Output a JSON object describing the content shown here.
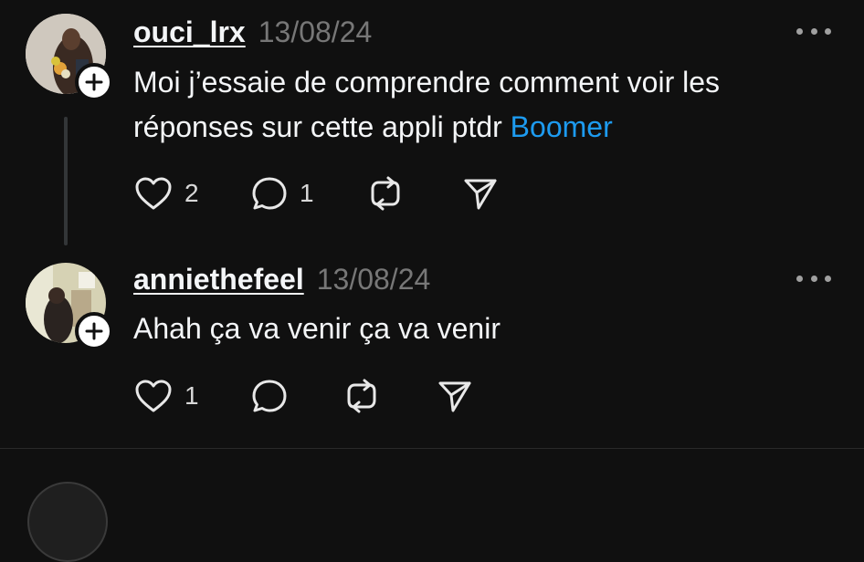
{
  "colors": {
    "background": "#101010",
    "text": "#f3f5f7",
    "muted": "#777777",
    "mention": "#1d9bf0"
  },
  "posts": [
    {
      "username": "ouci_lrx",
      "timestamp": "13/08/24",
      "text": "Moi j’essaie de comprendre comment voir les réponses sur cette appli ptdr ",
      "mention": "Boomer",
      "likes": "2",
      "replies": "1"
    },
    {
      "username": "anniethefeel",
      "timestamp": "13/08/24",
      "text": "Ahah ça va venir ça va venir",
      "likes": "1"
    }
  ],
  "icons": {
    "follow": "plus-icon",
    "more": "more-horizontal-icon",
    "like": "heart-icon",
    "reply": "comment-icon",
    "repost": "repost-icon",
    "share": "send-icon"
  }
}
